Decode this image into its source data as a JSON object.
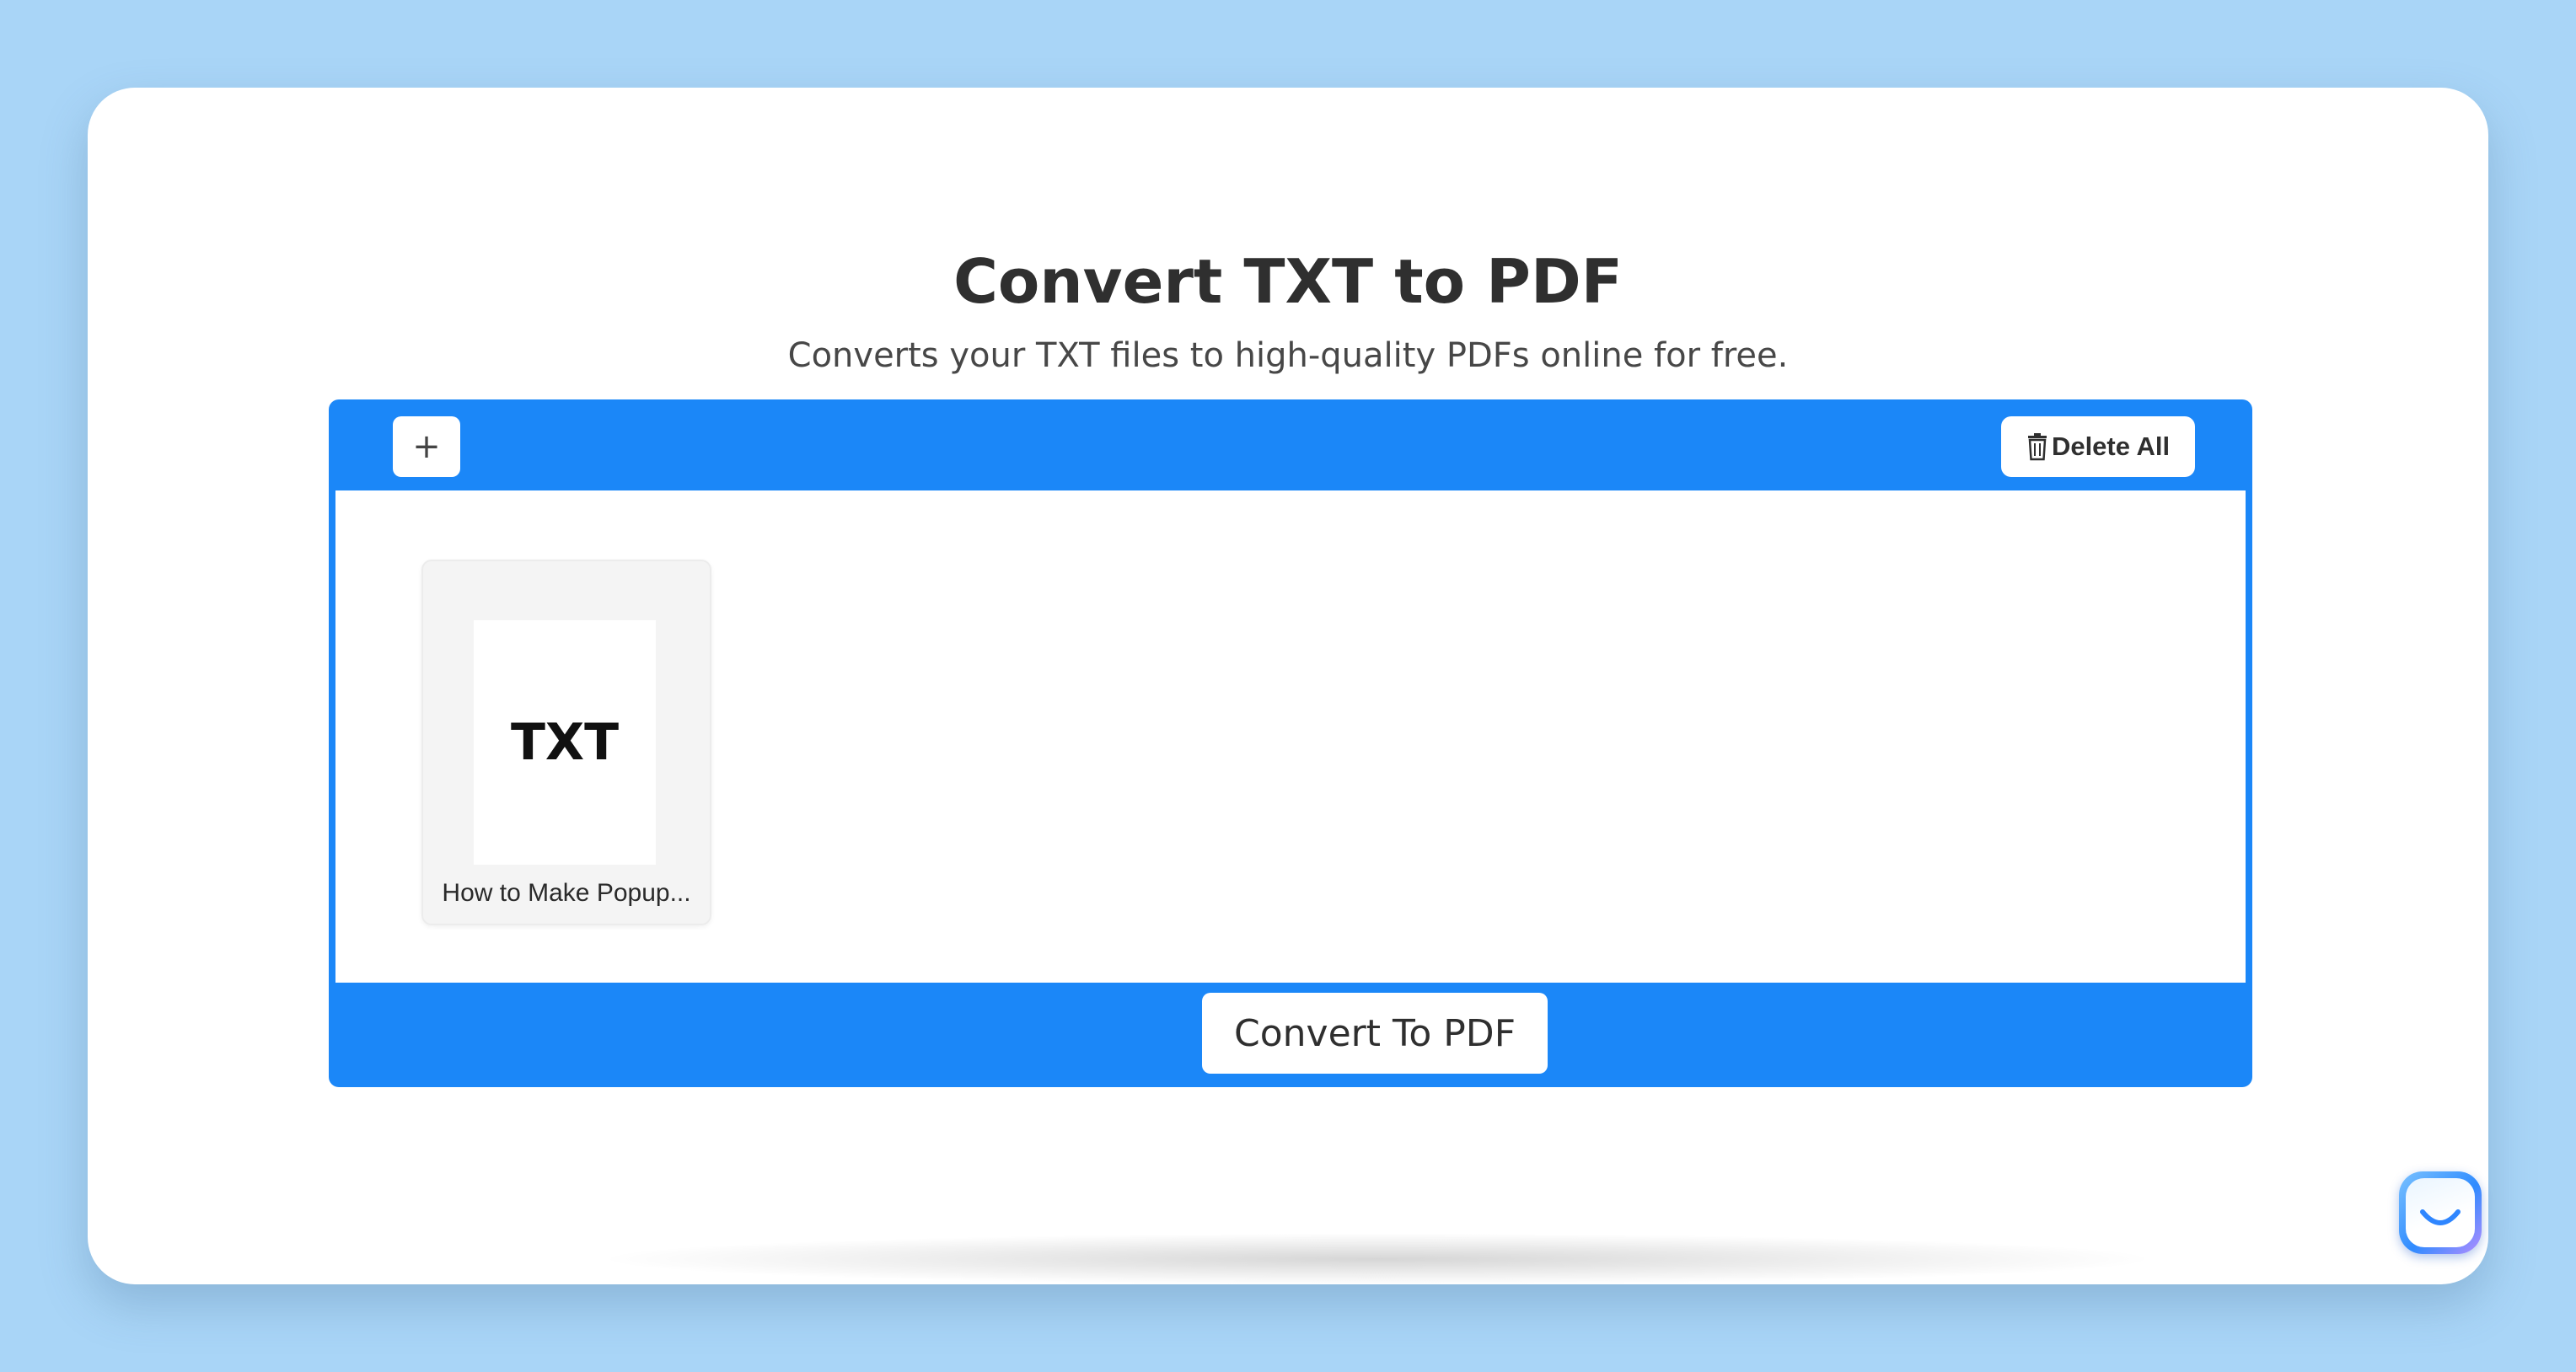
{
  "header": {
    "title": "Convert TXT to PDF",
    "subtitle": "Converts your TXT files to high-quality PDFs online for free."
  },
  "toolbar": {
    "add_label": "+",
    "delete_all_label": "Delete All"
  },
  "files": [
    {
      "thumbnail_label": "TXT",
      "name": "How to Make Popup..."
    }
  ],
  "actions": {
    "convert_label": "Convert To PDF"
  },
  "icons": {
    "delete": "trash-icon",
    "add": "plus-icon",
    "chat": "smile-chat-icon"
  },
  "colors": {
    "background": "#a9d5f7",
    "accent": "#1b87f8",
    "card": "#ffffff"
  }
}
